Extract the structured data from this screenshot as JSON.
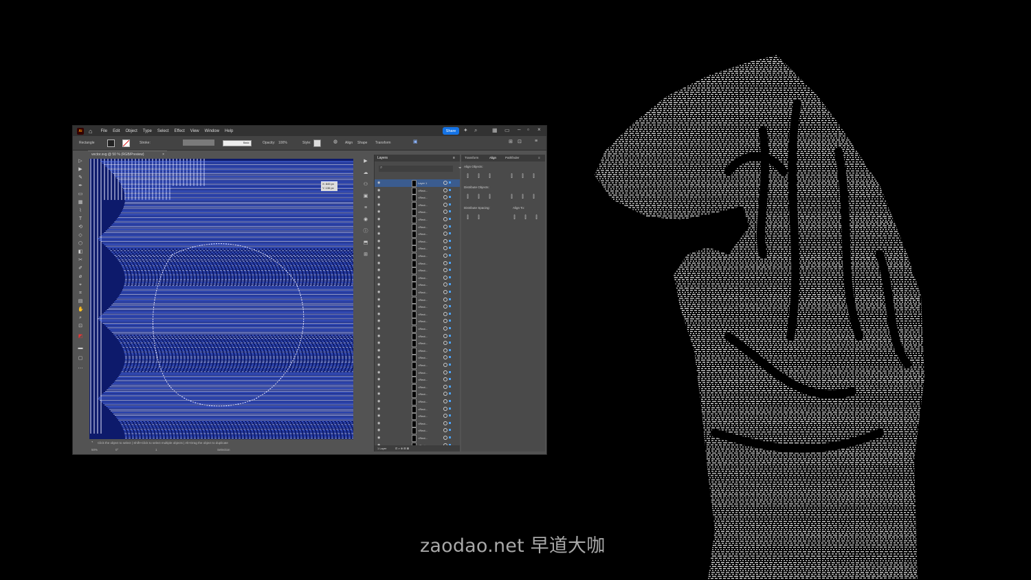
{
  "menubar": {
    "logo": "Ai",
    "items": [
      "File",
      "Edit",
      "Object",
      "Type",
      "Select",
      "Effect",
      "View",
      "Window",
      "Help"
    ],
    "share_label": "Share"
  },
  "control_bar": {
    "tool_name": "Rectangle",
    "stroke_label": "Stroke:",
    "basic_label": "Basic",
    "opacity_label": "Opacity:",
    "opacity_value": "100%",
    "style_label": "Style:",
    "align_label": "Align",
    "shape_label": "Shape",
    "transform_label": "Transform"
  },
  "document": {
    "tab_title": "vector.svg @ 50 % (RGB/Preview)",
    "tip_x": "X: 845 px",
    "tip_y": "Y: 136 px",
    "canvas_color": "#0d1a6b",
    "stroke_color": "#5a7dff"
  },
  "status_bar": {
    "hint": "Click the object to select  |  Shift+Click to select multiple objects  |  Alt+Drag the object to duplicate",
    "zoom": "50%",
    "angle": "0°",
    "artboard": "1",
    "mode": "Selection"
  },
  "layers_panel": {
    "title": "Layers",
    "top_layer": "Layer 1",
    "row_label": "<Rect...",
    "footer": "1 Layer"
  },
  "properties_panel": {
    "tabs": [
      "Transform",
      "Align",
      "Pathfinder"
    ],
    "active_tab": "Align",
    "align_objects": "Align Objects:",
    "distribute_objects": "Distribute Objects:",
    "distribute_spacing": "Distribute Spacing:",
    "align_to": "Align To:"
  },
  "watermark": {
    "text": "zaodao.net 早道大咖"
  }
}
